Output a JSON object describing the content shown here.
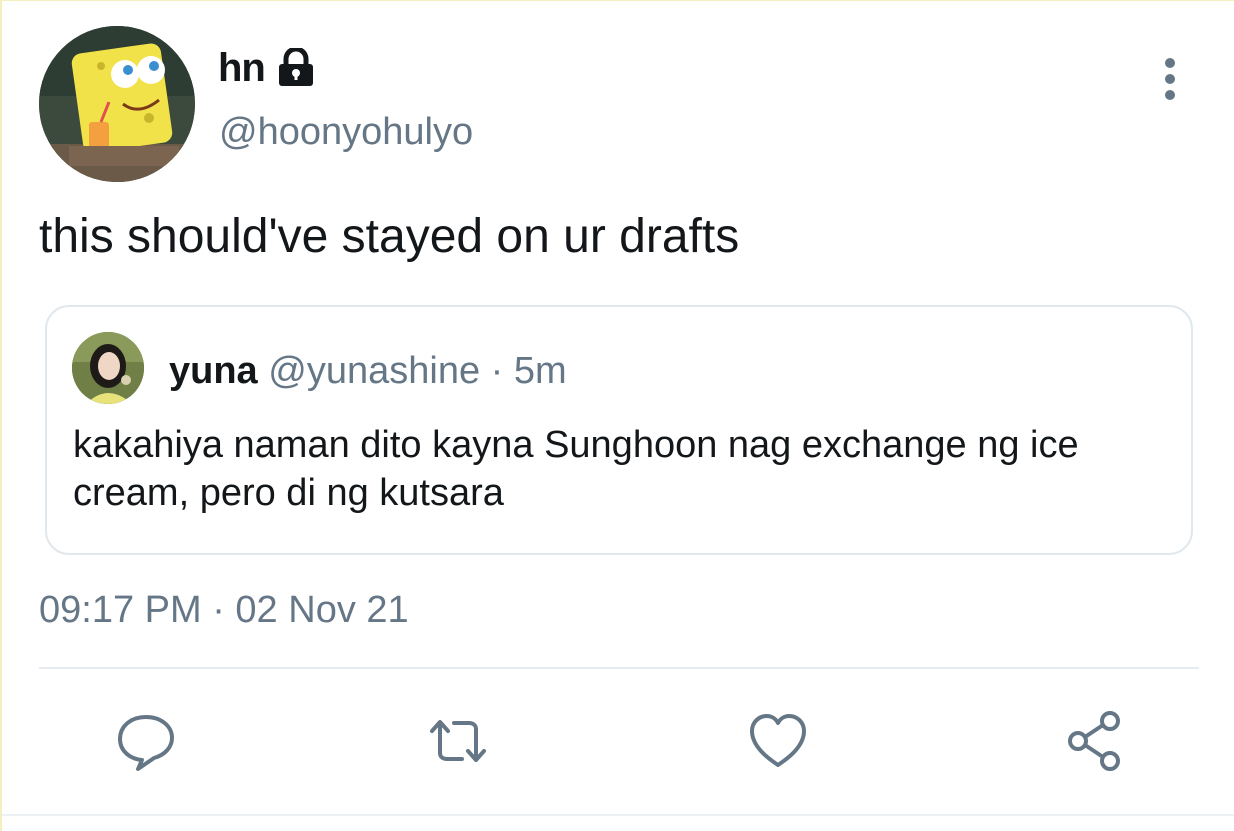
{
  "tweet": {
    "display_name": "hn",
    "protected_icon": "lock-icon",
    "handle": "@hoonyohulyo",
    "avatar_icon": "cartoon-avatar",
    "text": "this should've stayed on ur drafts",
    "more_icon": "more-vertical-icon",
    "timestamp": "09:17 PM · 02 Nov 21"
  },
  "quote": {
    "display_name": "yuna",
    "handle": "@yunashine",
    "separator": "·",
    "time": "5m",
    "avatar_icon": "photo-avatar",
    "text": "kakahiya naman dito kayna Sunghoon nag exchange ng ice cream, pero di ng kutsara"
  },
  "actions": [
    {
      "icon": "reply-icon"
    },
    {
      "icon": "retweet-icon"
    },
    {
      "icon": "like-icon"
    },
    {
      "icon": "share-icon"
    }
  ],
  "colors": {
    "text_primary": "#14171a",
    "text_secondary": "#657786",
    "icon": "#657786",
    "border": "#e1e8ed"
  }
}
